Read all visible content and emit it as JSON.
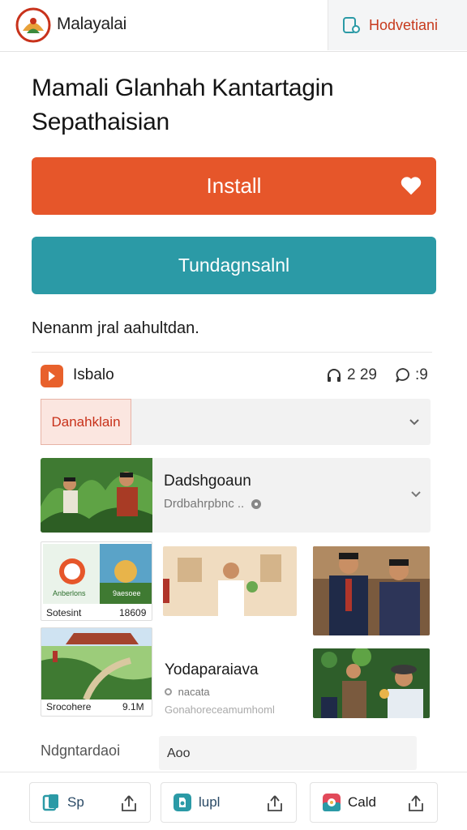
{
  "header": {
    "app_name": "Malayalai",
    "action_label": "Hodvetiani"
  },
  "title": "Mamali Glanhah Kantartagin Sepathaisian",
  "buttons": {
    "install_label": "Install",
    "secondary_label": "Tundagnsalnl"
  },
  "subtitle": "Nenanm jral aahultdan.",
  "info_row": {
    "label": "Isbalo",
    "stat_primary": "2 29",
    "stat_secondary": ":9"
  },
  "dropdown": {
    "selected": "Danahklain"
  },
  "media_card": {
    "title": "Dadshgoaun",
    "subtitle": "Drdbahrpbnc .."
  },
  "tiles": {
    "tile1_label": "Sotesint",
    "tile1_value": "18609",
    "tile1_inner_left": "Anberlons",
    "tile1_inner_right": "9aesoee",
    "tile2_label": "Srocohere",
    "tile2_value": "9.1M"
  },
  "text_block": {
    "title": "Yodaparaiava",
    "sub1": "nacata",
    "sub2": "Gonahoreceamumhoml"
  },
  "footer": {
    "label": "Ndgntardaoi",
    "field_value": "Aoo"
  },
  "bottom_bar": [
    {
      "label": "Sp",
      "icon": "clipboard-icon"
    },
    {
      "label": "lupl",
      "icon": "app-icon"
    },
    {
      "label": "Cald",
      "icon": "chat-icon"
    }
  ],
  "colors": {
    "accent_orange": "#e6562a",
    "accent_teal": "#2b9aa6",
    "danger_red": "#c8321b"
  }
}
